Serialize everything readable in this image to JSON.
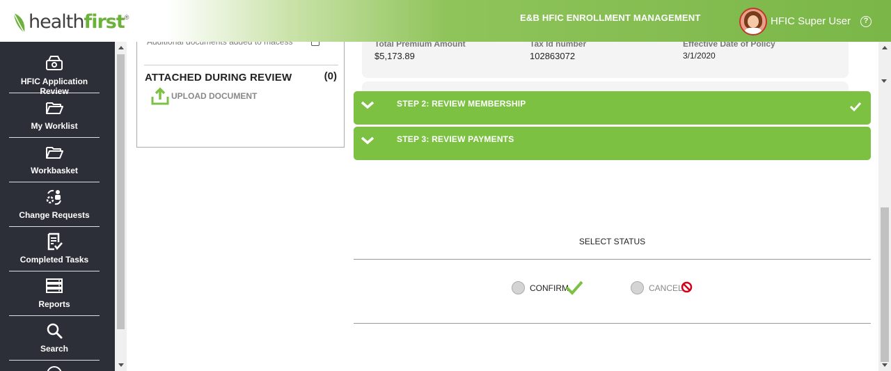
{
  "header": {
    "logo_prefix": "health",
    "logo_bold": "first",
    "logo_mark": "®",
    "app_title": "E&B HFIC ENROLLMENT MANAGEMENT",
    "user_name": "HFIC Super User",
    "help_glyph": "?"
  },
  "sidebar": {
    "items": [
      {
        "label": "HFIC Application Review",
        "icon": "inbox-icon"
      },
      {
        "label": "My Worklist",
        "icon": "folder-open-icon"
      },
      {
        "label": "Workbasket",
        "icon": "folder-open-icon"
      },
      {
        "label": "Change Requests",
        "icon": "change-requests-icon"
      },
      {
        "label": "Completed Tasks",
        "icon": "completed-tasks-icon"
      },
      {
        "label": "Reports",
        "icon": "reports-icon"
      },
      {
        "label": "Search",
        "icon": "search-icon"
      }
    ]
  },
  "documents": {
    "previous_item": "Additional documents added to macess",
    "attached_title": "ATTACHED DURING REVIEW",
    "attached_count": "(0)",
    "upload_label": "UPLOAD DOCUMENT"
  },
  "summary": {
    "total_premium_label": "Total Premium Amount",
    "total_premium_value": "$5,173.89",
    "tax_id_label": "Tax Id number",
    "tax_id_value": "102863072",
    "effective_date_label": "Effective Date of Policy",
    "effective_date_value": "3/1/2020"
  },
  "steps": [
    {
      "title": "STEP 2: REVIEW MEMBERSHIP",
      "completed": true
    },
    {
      "title": "STEP 3: REVIEW PAYMENTS",
      "completed": false
    }
  ],
  "status": {
    "title": "SELECT STATUS",
    "confirm_label": "CONFIRM",
    "cancel_label": "CANCEL"
  },
  "colors": {
    "brand_green": "#7dc142",
    "sidebar_bg": "#2c2f38",
    "cancel_red": "#d0021b"
  }
}
